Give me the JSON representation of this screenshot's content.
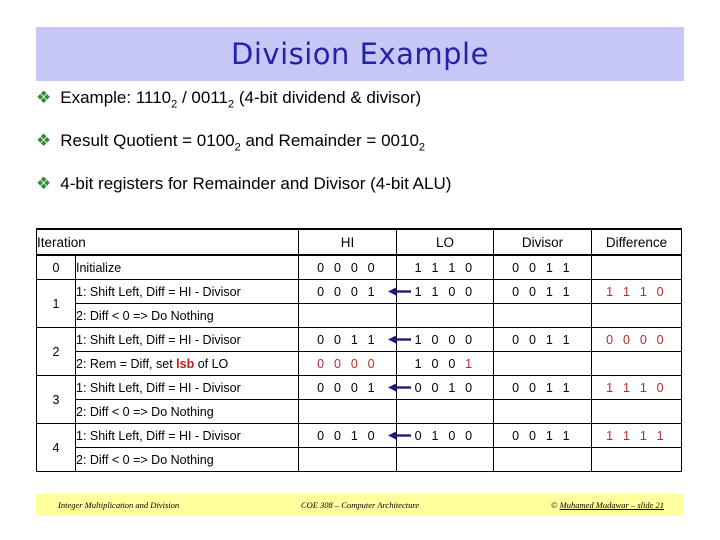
{
  "slide": {
    "title": "Division Example",
    "title_band_color": "#c6c6f7",
    "title_text_color": "#2222aa"
  },
  "bullets": [
    {
      "mark": "diamond-bullet-icon",
      "parts": [
        {
          "t": "Example: 1110",
          "s": false
        },
        {
          "t": "2",
          "s": true
        },
        {
          "t": " / 0011",
          "s": false
        },
        {
          "t": "2",
          "s": true
        },
        {
          "t": " (4-bit dividend & divisor)",
          "s": false
        }
      ]
    },
    {
      "mark": "diamond-bullet-icon",
      "parts": [
        {
          "t": "Result Quotient = 0100",
          "s": false
        },
        {
          "t": "2",
          "s": true
        },
        {
          "t": " and Remainder = 0010",
          "s": false
        },
        {
          "t": "2",
          "s": true
        }
      ]
    },
    {
      "mark": "diamond-bullet-icon",
      "parts": [
        {
          "t": "4-bit registers for Remainder and Divisor (4-bit ALU)",
          "s": false
        }
      ]
    }
  ],
  "table": {
    "headers": {
      "iteration": "Iteration",
      "hi": "HI",
      "lo": "LO",
      "divisor": "Divisor",
      "difference": "Difference"
    },
    "rows": [
      {
        "iteration": "0",
        "lines": [
          {
            "desc": "Initialize",
            "desc_bold_word": "",
            "hi": "0 0 0 0",
            "hi_red": false,
            "lo": "1 1 1 0",
            "lo_red": false,
            "lo_last_red": false,
            "divisor": "0 0 1 1",
            "difference": "",
            "difference_red": true,
            "arrow": false
          }
        ]
      },
      {
        "iteration": "1",
        "lines": [
          {
            "desc": "1: Shift Left, Diff = HI - Divisor",
            "desc_bold_word": "",
            "hi": "0 0 0 1",
            "hi_red": false,
            "lo": "1 1 0 0",
            "lo_red": false,
            "lo_last_red": false,
            "divisor": "0 0 1 1",
            "difference": "1 1 1 0",
            "difference_red": true,
            "arrow": true
          },
          {
            "desc": "2: Diff < 0 => Do Nothing",
            "desc_bold_word": "",
            "hi": "",
            "hi_red": false,
            "lo": "",
            "lo_red": false,
            "lo_last_red": false,
            "divisor": "",
            "difference": "",
            "difference_red": true,
            "arrow": false
          }
        ]
      },
      {
        "iteration": "2",
        "lines": [
          {
            "desc": "1: Shift Left, Diff = HI - Divisor",
            "desc_bold_word": "",
            "hi": "0 0 1 1",
            "hi_red": false,
            "lo": "1 0 0 0",
            "lo_red": false,
            "lo_last_red": false,
            "divisor": "0 0 1 1",
            "difference": "0 0 0 0",
            "difference_red": true,
            "arrow": true
          },
          {
            "desc": "2: Rem = Diff, set lsb of LO",
            "desc_bold_word": "lsb",
            "hi": "0 0 0 0",
            "hi_red": true,
            "lo": "1 0 0 1",
            "lo_red": false,
            "lo_last_red": true,
            "divisor": "",
            "difference": "",
            "difference_red": true,
            "arrow": false
          }
        ]
      },
      {
        "iteration": "3",
        "lines": [
          {
            "desc": "1: Shift Left, Diff = HI - Divisor",
            "desc_bold_word": "",
            "hi": "0 0 0 1",
            "hi_red": false,
            "lo": "0 0 1 0",
            "lo_red": false,
            "lo_last_red": false,
            "divisor": "0 0 1 1",
            "difference": "1 1 1 0",
            "difference_red": true,
            "arrow": true
          },
          {
            "desc": "2: Diff < 0 => Do Nothing",
            "desc_bold_word": "",
            "hi": "",
            "hi_red": false,
            "lo": "",
            "lo_red": false,
            "lo_last_red": false,
            "divisor": "",
            "difference": "",
            "difference_red": true,
            "arrow": false
          }
        ]
      },
      {
        "iteration": "4",
        "lines": [
          {
            "desc": "1: Shift Left, Diff = HI - Divisor",
            "desc_bold_word": "",
            "hi": "0 0 1 0",
            "hi_red": false,
            "lo": "0 1 0 0",
            "lo_red": false,
            "lo_last_red": false,
            "divisor": "0 0 1 1",
            "difference": "1 1 1 1",
            "difference_red": true,
            "arrow": true
          },
          {
            "desc": "2: Diff < 0 => Do Nothing",
            "desc_bold_word": "",
            "hi": "",
            "hi_red": false,
            "lo": "",
            "lo_red": false,
            "lo_last_red": false,
            "divisor": "",
            "difference": "",
            "difference_red": true,
            "arrow": false
          }
        ]
      }
    ],
    "arrow_color": "#1a1a7a",
    "red_value_color": "#b82c2c"
  },
  "footer": {
    "left": "Integer Multiplication and Division",
    "center": "COE 308 – Computer Architecture",
    "right_prefix": "© ",
    "right": "Muhamed Mudawar – slide 21",
    "background": "#ffff9e"
  }
}
